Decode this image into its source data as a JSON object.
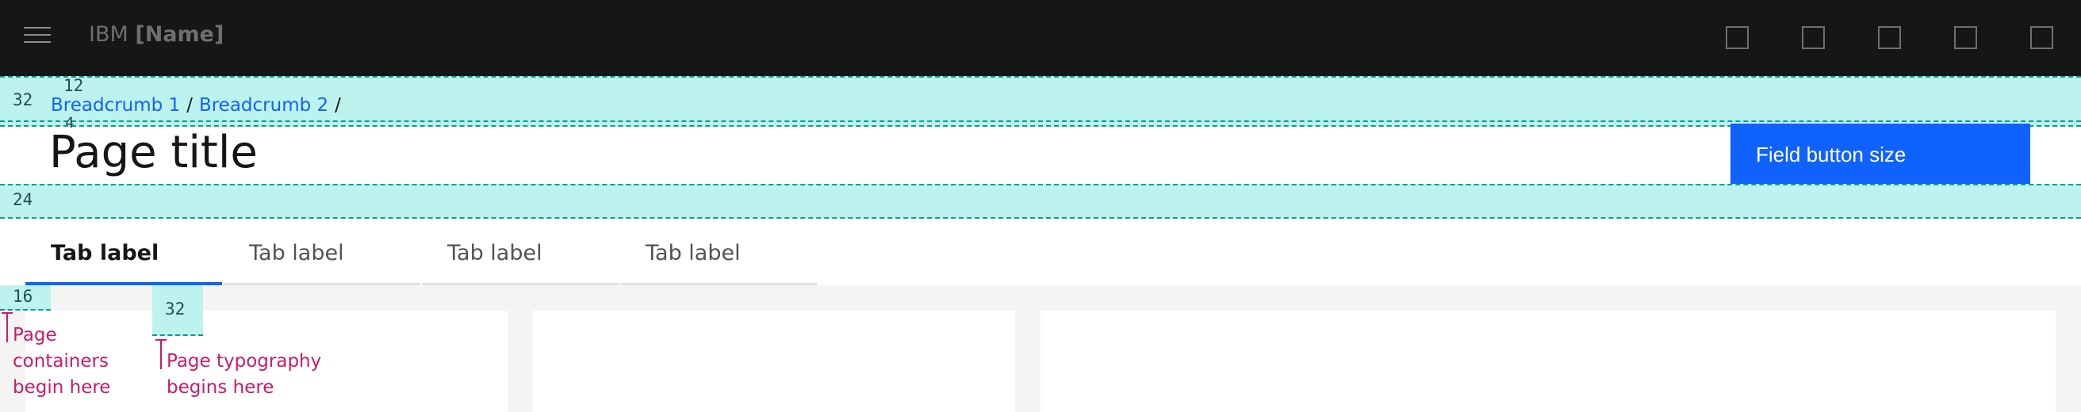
{
  "header": {
    "brand_prefix": "IBM",
    "brand_name": "[Name]",
    "menu_icon": "hamburger-menu-icon",
    "action_icon": "square-placeholder-icon"
  },
  "breadcrumbs": {
    "items": [
      "Breadcrumb 1",
      "Breadcrumb 2"
    ],
    "separator": "/"
  },
  "page": {
    "title": "Page title",
    "field_button_label": "Field button size"
  },
  "tabs": [
    {
      "label": "Tab label",
      "active": true
    },
    {
      "label": "Tab label",
      "active": false
    },
    {
      "label": "Tab label",
      "active": false
    },
    {
      "label": "Tab label",
      "active": false
    }
  ],
  "spacing": {
    "top": "32",
    "above_breadcrumb": "12",
    "below_breadcrumb": "4",
    "below_title": "24",
    "container_margin": "16",
    "typography_margin": "32"
  },
  "annotations": {
    "containers": "Page containers begin here",
    "typography": "Page typography begins here"
  },
  "colors": {
    "header_bg": "#161616",
    "accent": "#0f62fe",
    "spacer": "#bdf3ef",
    "annotation": "#c71c6b"
  }
}
